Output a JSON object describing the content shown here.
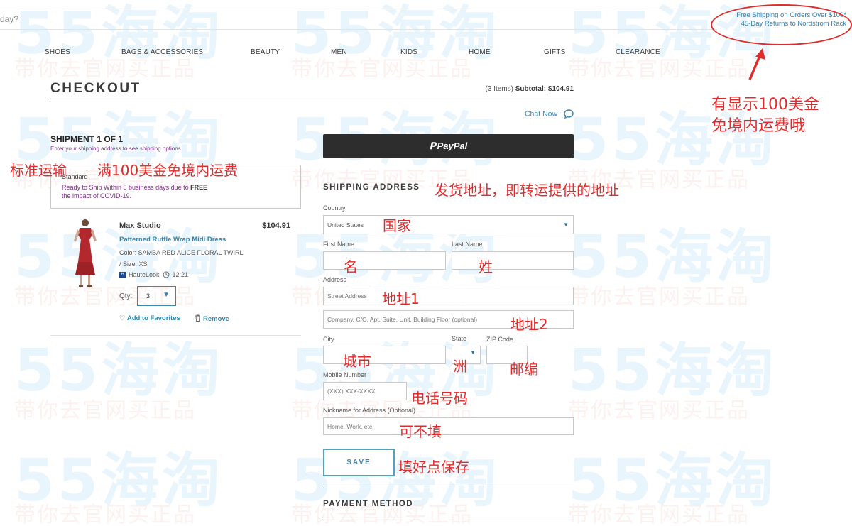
{
  "watermark": {
    "brand": "55海淘",
    "slogan": "带你去官网买正品"
  },
  "search": {
    "placeholder_fragment": "day?"
  },
  "promo": {
    "line1": "Free Shipping on Orders Over $100*",
    "line2": "45-Day Returns to Nordstrom Rack"
  },
  "nav": [
    "SHOES",
    "BAGS & ACCESSORIES",
    "BEAUTY",
    "MEN",
    "KIDS",
    "HOME",
    "GIFTS",
    "CLEARANCE"
  ],
  "checkout": {
    "title": "CHECKOUT",
    "items": "(3 Items)",
    "subtotal_label": "Subtotal:",
    "subtotal_value": "$104.91",
    "chat": "Chat Now"
  },
  "shipment": {
    "title": "SHIPMENT 1 OF 1",
    "subtitle": "Enter your shipping address to see shipping options.",
    "standard_name": "Standard",
    "standard_text_a": "Ready to Ship Within 5 business days due to",
    "standard_text_b": "FREE",
    "standard_text_c": "the impact of COVID-19."
  },
  "product": {
    "brand": "Max Studio",
    "price": "$104.91",
    "name": "Patterned Ruffle Wrap Midi Dress",
    "color_line": "Color: SAMBA RED ALICE FLORAL TWIRL",
    "size_line": "/ Size: XS",
    "seller_badge": "H",
    "seller": "HauteLook",
    "time": "12:21",
    "qty_label": "Qty:",
    "qty_value": "3",
    "favorites": "Add to Favorites",
    "remove": "Remove",
    "dress_color": "#b3282d"
  },
  "form": {
    "paypal": "PayPal",
    "section": "SHIPPING ADDRESS",
    "country_label": "Country",
    "country_value": "United States",
    "first_label": "First Name",
    "last_label": "Last Name",
    "address_label": "Address",
    "street_ph": "Street Address",
    "company_ph": "Company, C/O, Apt, Suite, Unit, Building Floor (optional)",
    "city_label": "City",
    "state_label": "State",
    "zip_label": "ZIP Code",
    "mobile_label": "Mobile Number",
    "mobile_ph": "(XXX) XXX-XXXX",
    "nickname_label": "Nickname for Address (Optional)",
    "nickname_ph": "Home, Work, etc.",
    "save": "SAVE",
    "payment": "PAYMENT METHOD"
  },
  "annotations": {
    "promo_note_1": "有显示100美金",
    "promo_note_2": "免境内运费哦",
    "standard": "标准运输",
    "free_over": "满100美金免境内运费",
    "ship_addr": "发货地址，即转运提供的地址",
    "country": "国家",
    "first": "名",
    "last": "姓",
    "addr1": "地址1",
    "addr2": "地址2",
    "city": "城市",
    "state": "洲",
    "zip": "邮编",
    "phone": "电话号码",
    "optional": "可不填",
    "save": "填好点保存"
  },
  "colors": {
    "accent": "#3a86b3",
    "purple": "#7c2f86",
    "annotation": "#e12b2b"
  }
}
